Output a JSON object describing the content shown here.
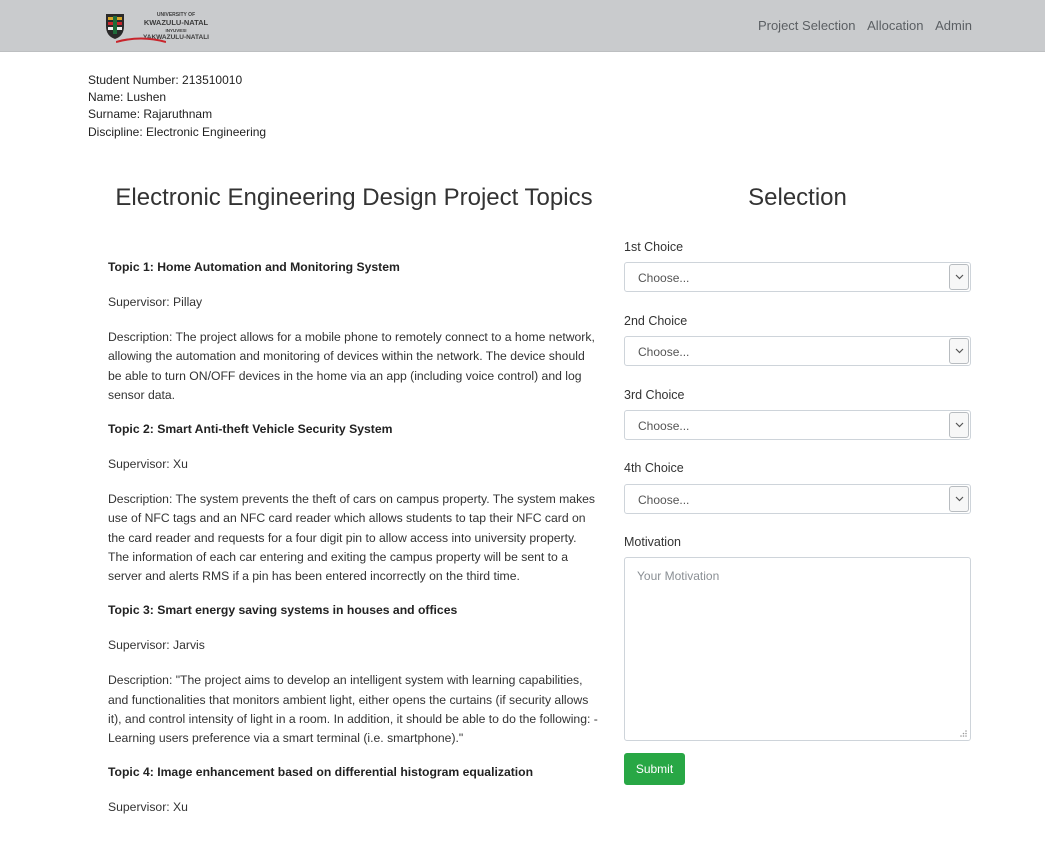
{
  "brand": {
    "line1": "UNIVERSITY OF",
    "line2": "KWAZULU-NATAL",
    "line3": "INYUVESI",
    "line4": "YAKWAZULU-NATALI"
  },
  "nav": {
    "project_selection": "Project Selection",
    "allocation": "Allocation",
    "admin": "Admin"
  },
  "student": {
    "number": "Student Number: 213510010",
    "name": "Name: Lushen",
    "surname": "Surname: Rajaruthnam",
    "discipline": "Discipline: Electronic Engineering"
  },
  "topics_heading": "Electronic Engineering Design Project Topics",
  "topics": [
    {
      "title": "Topic 1: Home Automation and Monitoring System",
      "supervisor": "Supervisor: Pillay",
      "description": "Description: The project allows for a mobile phone to remotely connect to a home network, allowing the automation and monitoring of devices within the network. The device should be able to turn ON/OFF devices in the home via an app (including voice control) and log sensor data."
    },
    {
      "title": "Topic 2: Smart Anti-theft Vehicle Security System",
      "supervisor": "Supervisor: Xu",
      "description": "Description: The system prevents the theft of cars on campus property. The system makes use of NFC tags and an NFC card reader which allows students to tap their NFC card on the card reader and requests for a four digit pin to allow access into university property. The information of each car entering and exiting the campus property will be sent to a server and alerts RMS if a pin has been entered incorrectly on the third time."
    },
    {
      "title": "Topic 3: Smart energy saving systems in houses and offices",
      "supervisor": "Supervisor: Jarvis",
      "description": "Description: \"The project aims to develop an intelligent system with learning capabilities, and functionalities that monitors ambient light, either opens the curtains (if security allows it), and control intensity of light in a room. In addition, it should be able to do the following: - Learning users preference via a smart terminal (i.e. smartphone).\""
    },
    {
      "title": "Topic 4: Image enhancement based on differential histogram equalization",
      "supervisor": "Supervisor: Xu"
    }
  ],
  "selection": {
    "heading": "Selection",
    "choices": [
      {
        "label": "1st Choice",
        "value": "Choose..."
      },
      {
        "label": "2nd Choice",
        "value": "Choose..."
      },
      {
        "label": "3rd Choice",
        "value": "Choose..."
      },
      {
        "label": "4th Choice",
        "value": "Choose..."
      }
    ],
    "motivation_label": "Motivation",
    "motivation_placeholder": "Your Motivation",
    "submit_label": "Submit"
  },
  "colors": {
    "navbar": "#c9cbcd",
    "submit": "#28a745"
  }
}
